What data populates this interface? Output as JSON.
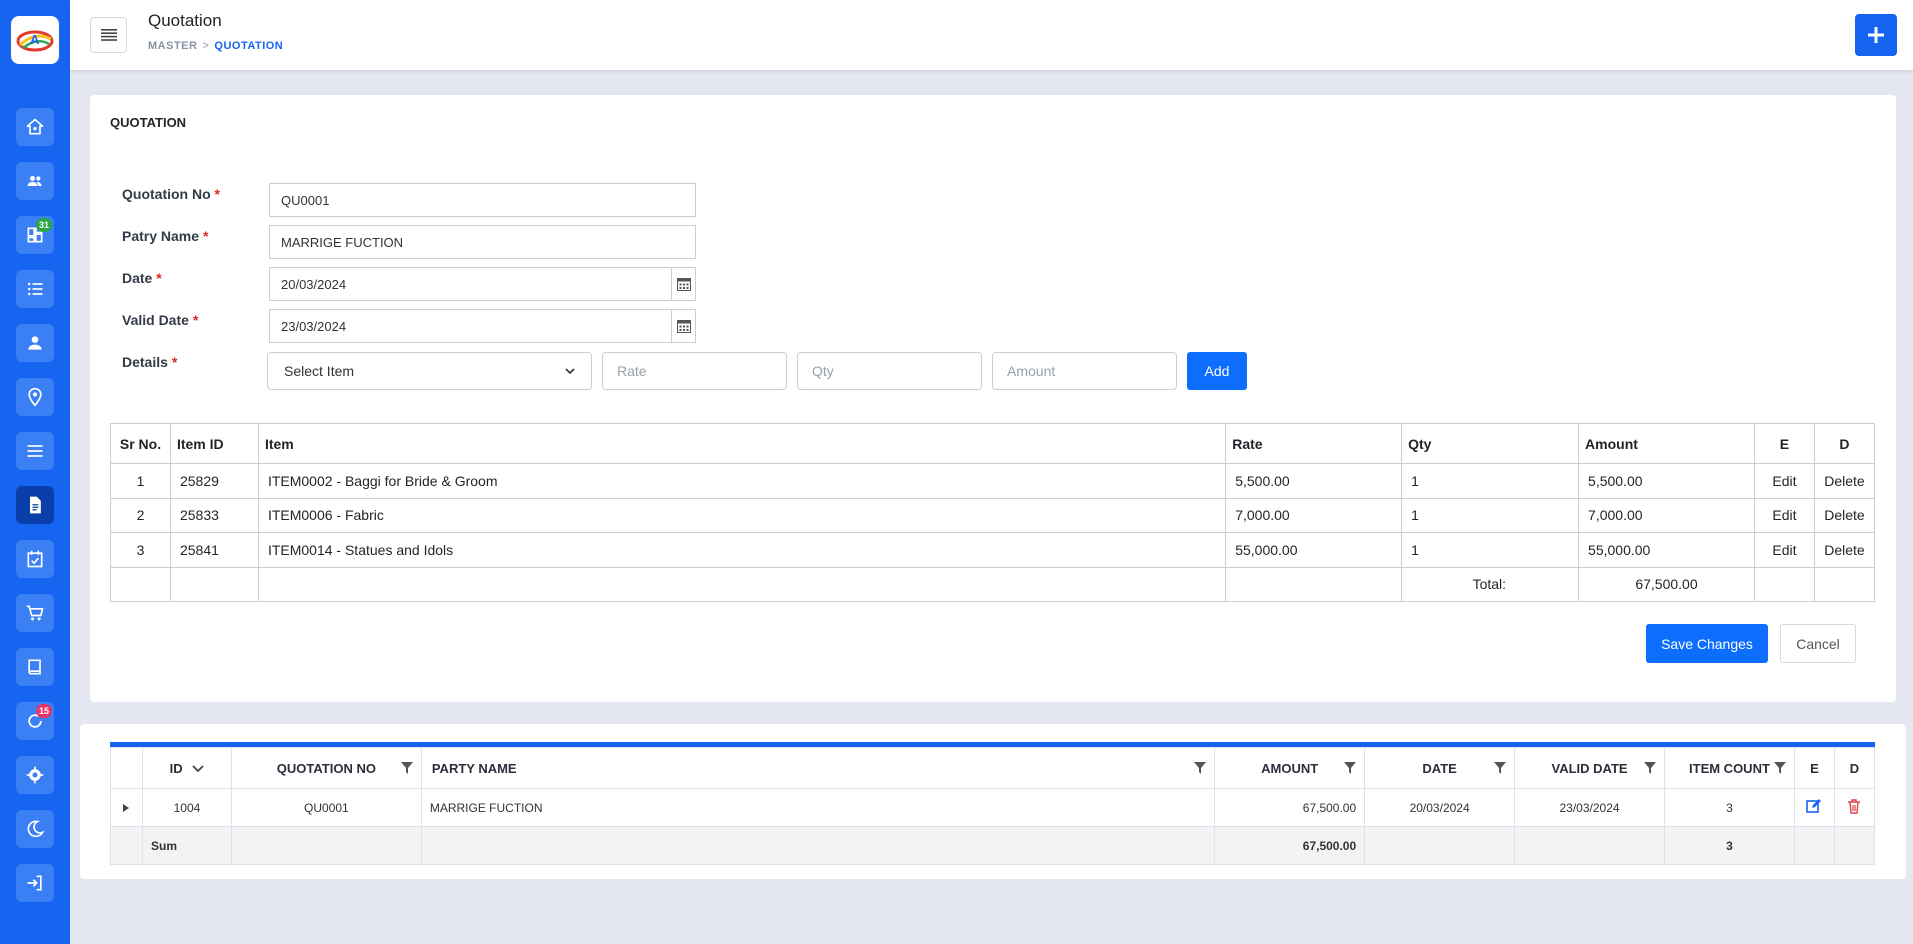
{
  "header": {
    "title": "Quotation",
    "breadcrumb": {
      "parent": "MASTER",
      "separator": ">",
      "current": "QUOTATION"
    }
  },
  "sidebar": {
    "items": [
      {
        "icon": "home-icon"
      },
      {
        "icon": "users-icon"
      },
      {
        "icon": "dashboard-icon",
        "badge": "31",
        "badge_color": "#28a745"
      },
      {
        "icon": "list-icon"
      },
      {
        "icon": "user-icon"
      },
      {
        "icon": "location-icon"
      },
      {
        "icon": "menu-lines-icon"
      },
      {
        "icon": "document-icon",
        "active": true
      },
      {
        "icon": "calendar-check-icon"
      },
      {
        "icon": "cart-icon"
      },
      {
        "icon": "book-icon"
      },
      {
        "icon": "refresh-icon",
        "badge": "15",
        "badge_color": "#e8336b"
      },
      {
        "icon": "gear-icon"
      },
      {
        "icon": "moon-icon"
      },
      {
        "icon": "logout-icon"
      }
    ]
  },
  "form": {
    "card_title": "QUOTATION",
    "quotation_no_label": "Quotation No",
    "quotation_no_value": "QU0001",
    "party_name_label": "Patry Name",
    "party_name_value": "MARRIGE FUCTION",
    "date_label": "Date",
    "date_value": "20/03/2024",
    "valid_date_label": "Valid Date",
    "valid_date_value": "23/03/2024",
    "details_label": "Details",
    "required_mark": "*",
    "select_item_placeholder": "Select Item",
    "rate_placeholder": "Rate",
    "qty_placeholder": "Qty",
    "amount_placeholder": "Amount",
    "add_button": "Add"
  },
  "items_table": {
    "headers": {
      "sr": "Sr No.",
      "item_id": "Item ID",
      "item": "Item",
      "rate": "Rate",
      "qty": "Qty",
      "amount": "Amount",
      "e": "E",
      "d": "D"
    },
    "rows": [
      {
        "sr": "1",
        "item_id": "25829",
        "item": "ITEM0002 - Baggi for Bride & Groom",
        "rate": "5,500.00",
        "qty": "1",
        "amount": "5,500.00",
        "edit": "Edit",
        "delete": "Delete"
      },
      {
        "sr": "2",
        "item_id": "25833",
        "item": "ITEM0006 - Fabric",
        "rate": "7,000.00",
        "qty": "1",
        "amount": "7,000.00",
        "edit": "Edit",
        "delete": "Delete"
      },
      {
        "sr": "3",
        "item_id": "25841",
        "item": "ITEM0014 - Statues and Idols",
        "rate": "55,000.00",
        "qty": "1",
        "amount": "55,000.00",
        "edit": "Edit",
        "delete": "Delete"
      }
    ],
    "total_label": "Total:",
    "total_value": "67,500.00"
  },
  "actions": {
    "save": "Save Changes",
    "cancel": "Cancel"
  },
  "grid": {
    "headers": {
      "id": "ID",
      "quotation_no": "QUOTATION NO",
      "party_name": "PARTY NAME",
      "amount": "AMOUNT",
      "date": "DATE",
      "valid_date": "VALID DATE",
      "item_count": "ITEM COUNT",
      "e": "E",
      "d": "D"
    },
    "rows": [
      {
        "id": "1004",
        "quotation_no": "QU0001",
        "party_name": "MARRIGE FUCTION",
        "amount": "67,500.00",
        "date": "20/03/2024",
        "valid_date": "23/03/2024",
        "item_count": "3"
      }
    ],
    "sum": {
      "label": "Sum",
      "amount": "67,500.00",
      "item_count": "3"
    }
  }
}
